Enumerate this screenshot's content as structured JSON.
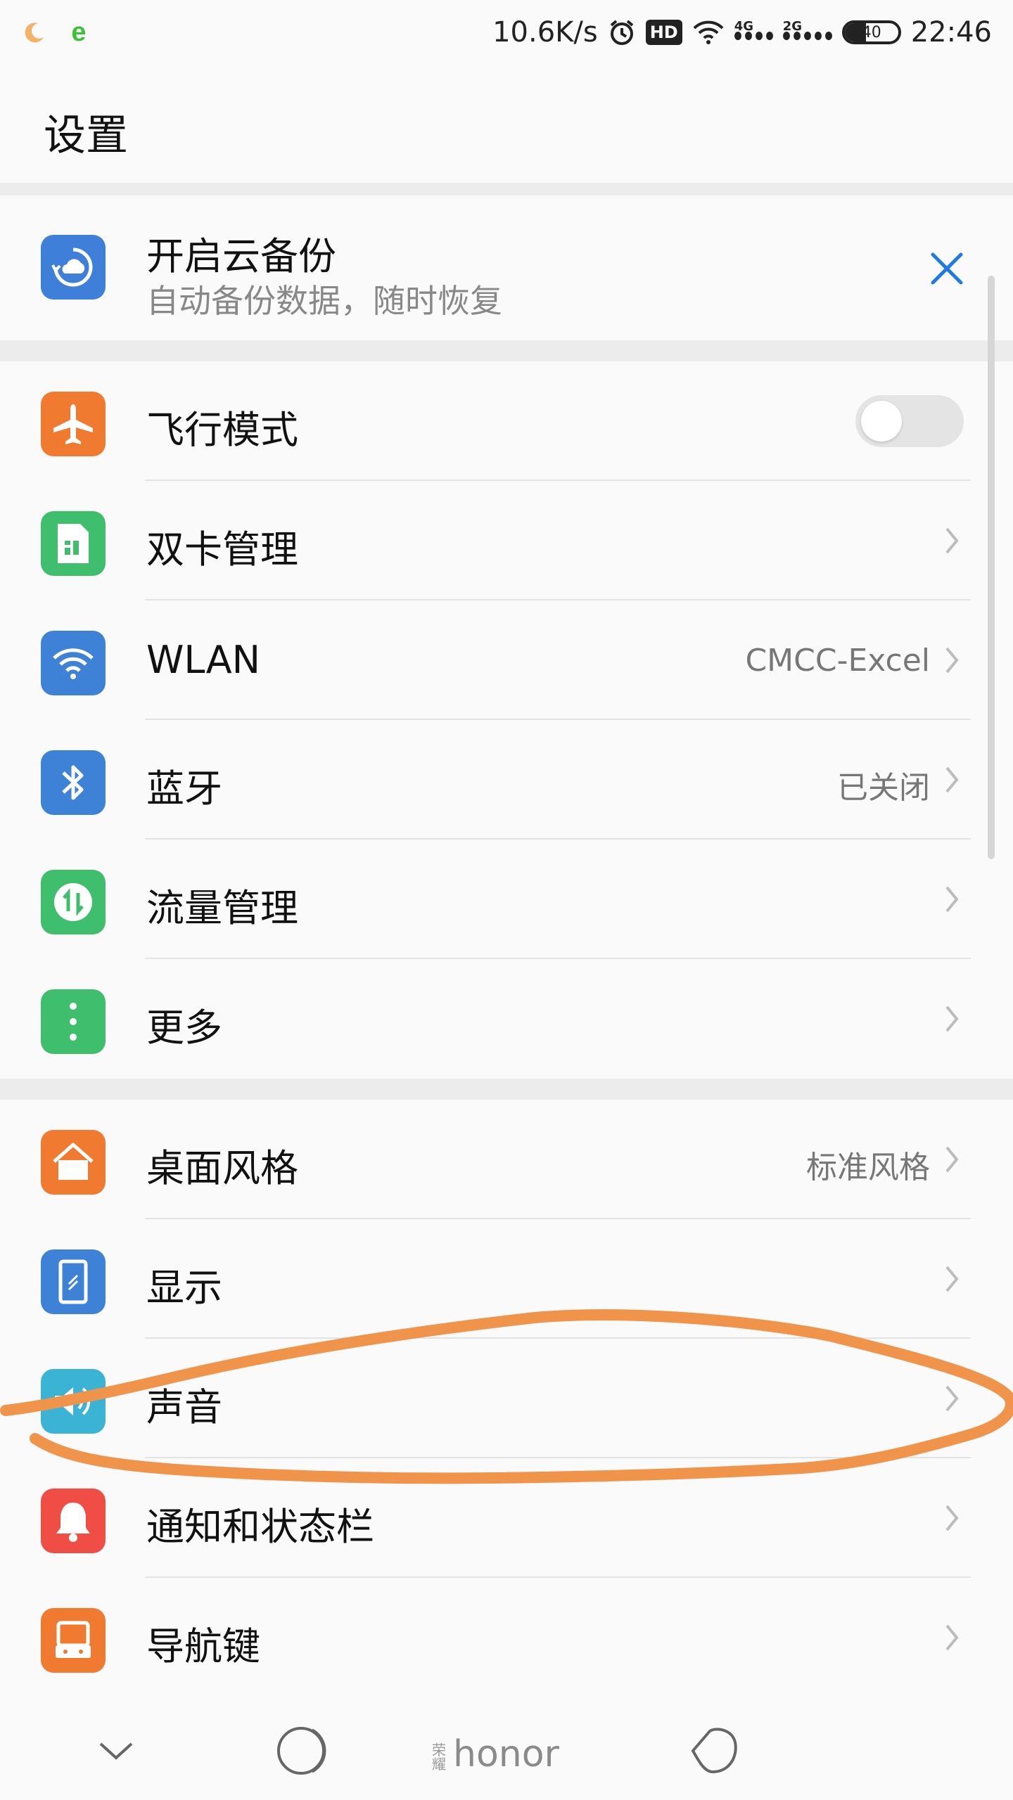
{
  "status_bar": {
    "net_speed": "10.6K/s",
    "hd_badge": "HD",
    "sim1_type": "4G",
    "sim2_type": "2G",
    "battery": "40",
    "battery_level": 0.4,
    "time": "22:46"
  },
  "header": {
    "title": "设置"
  },
  "backup_card": {
    "title": "开启云备份",
    "subtitle": "自动备份数据，随时恢复"
  },
  "network_section": {
    "items": [
      {
        "label": "飞行模式",
        "icon": "airplane-icon",
        "color": "#f07a2f",
        "toggle_on": false
      },
      {
        "label": "双卡管理",
        "icon": "sim-card-icon",
        "color": "#3fbf6d"
      },
      {
        "label": "WLAN",
        "icon": "wifi-icon",
        "color": "#3e82d8",
        "value": "CMCC-Excel"
      },
      {
        "label": "蓝牙",
        "icon": "bluetooth-icon",
        "color": "#3e82d8",
        "value": "已关闭"
      },
      {
        "label": "流量管理",
        "icon": "data-usage-icon",
        "color": "#3fbf6d"
      },
      {
        "label": "更多",
        "icon": "more-icon",
        "color": "#3fbf6d"
      }
    ]
  },
  "device_section": {
    "items": [
      {
        "label": "桌面风格",
        "icon": "home-icon",
        "color": "#f07a2f",
        "value": "标准风格"
      },
      {
        "label": "显示",
        "icon": "display-icon",
        "color": "#3e82d8"
      },
      {
        "label": "声音",
        "icon": "sound-icon",
        "color": "#3bb3d4"
      },
      {
        "label": "通知和状态栏",
        "icon": "bell-icon",
        "color": "#f04e44"
      },
      {
        "label": "导航键",
        "icon": "navigation-key-icon",
        "color": "#f07a2f"
      }
    ]
  },
  "navbar": {
    "brand_logo": "honor"
  },
  "annotation_color": "#f0944c"
}
